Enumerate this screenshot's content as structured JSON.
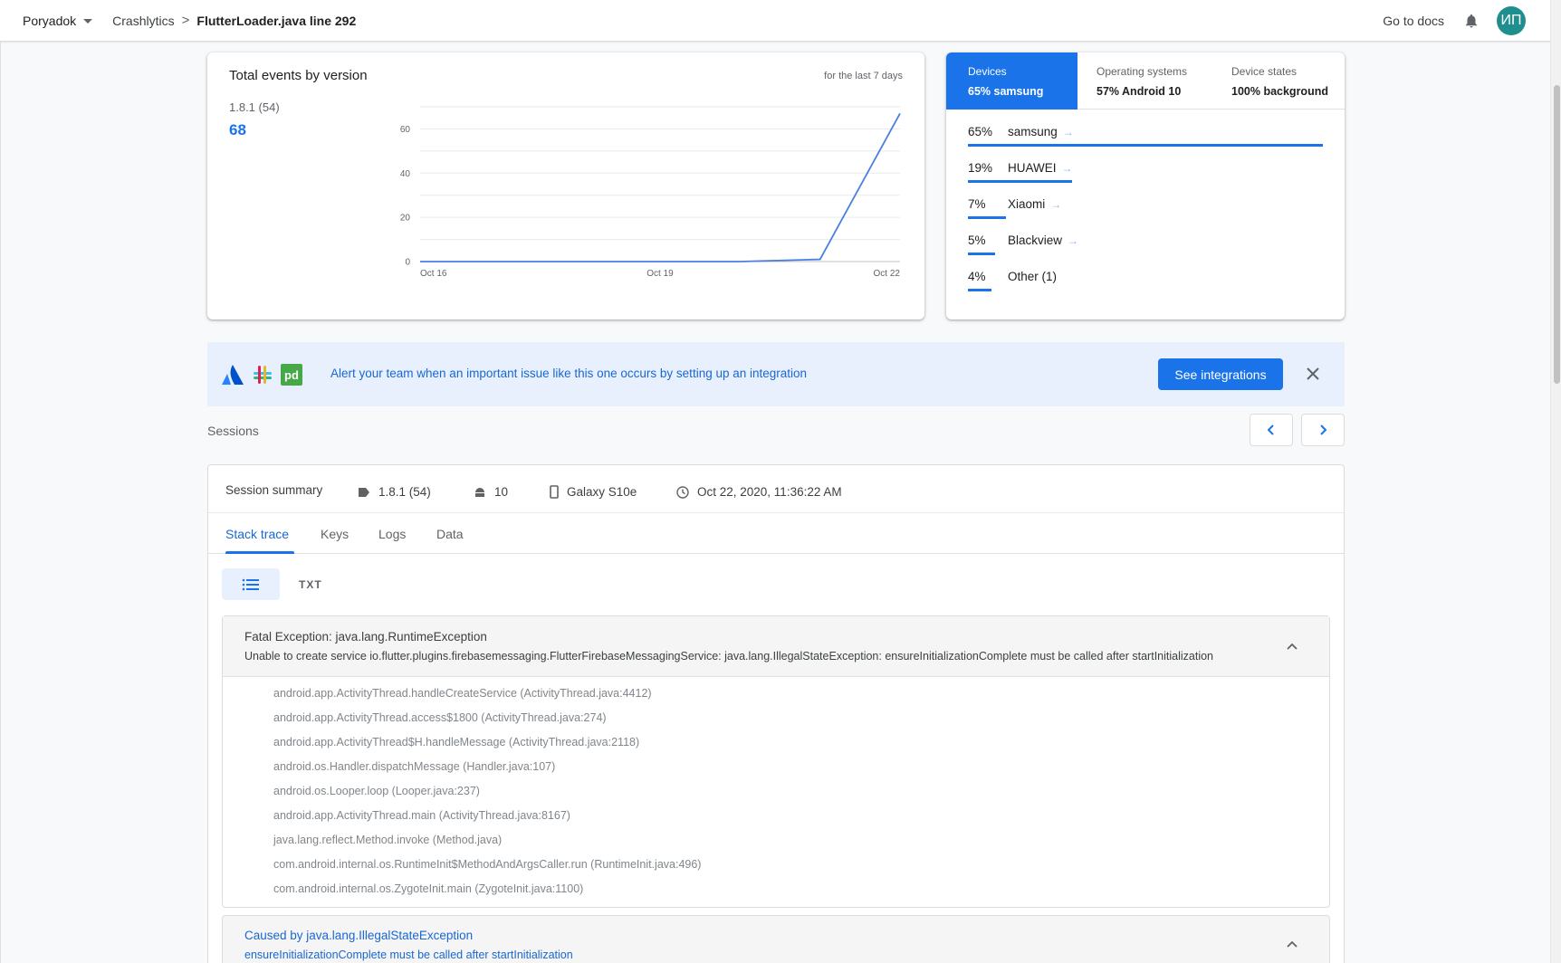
{
  "topbar": {
    "project": "Poryadok",
    "section": "Crashlytics",
    "separator": ">",
    "current": "FlutterLoader.java line 292",
    "docs": "Go to docs",
    "avatar": "ИП"
  },
  "chart_data": {
    "type": "line",
    "title": "Total events by version",
    "range_label": "for the last 7 days",
    "version_label": "1.8.1 (54)",
    "total": "68",
    "x": [
      "Oct 16",
      "Oct 17",
      "Oct 18",
      "Oct 19",
      "Oct 20",
      "Oct 21",
      "Oct 22"
    ],
    "x_tick_labels": [
      "Oct 16",
      "Oct 19",
      "Oct 22"
    ],
    "series": [
      {
        "values": [
          0,
          0,
          0,
          0,
          0,
          1,
          67
        ]
      }
    ],
    "y_ticks": [
      0,
      20,
      40,
      60
    ],
    "ylim": [
      0,
      70
    ],
    "grid": true,
    "color": "#4a7fe0"
  },
  "devices": {
    "tabs": [
      {
        "label": "Devices",
        "value": "65% samsung"
      },
      {
        "label": "Operating systems",
        "value": "57% Android 10"
      },
      {
        "label": "Device states",
        "value": "100% background"
      }
    ],
    "rows": [
      {
        "pct": "65%",
        "name": "samsung",
        "share": 65,
        "arrow": "→"
      },
      {
        "pct": "19%",
        "name": "HUAWEI",
        "share": 19,
        "arrow": "→"
      },
      {
        "pct": "7%",
        "name": "Xiaomi",
        "share": 7,
        "arrow": "→"
      },
      {
        "pct": "5%",
        "name": "Blackview",
        "share": 5,
        "arrow": "→"
      },
      {
        "pct": "4%",
        "name": "Other (1)",
        "share": 4,
        "arrow": ""
      }
    ]
  },
  "alert": {
    "message": "Alert your team when an important issue like this one occurs by setting up an integration",
    "button": "See integrations",
    "pd_logo": "pd"
  },
  "sessions": {
    "label": "Sessions",
    "summary_label": "Session summary",
    "version": "1.8.1 (54)",
    "os": "10",
    "device": "Galaxy S10e",
    "timestamp": "Oct 22, 2020, 11:36:22 AM",
    "tabs": [
      "Stack trace",
      "Keys",
      "Logs",
      "Data"
    ],
    "txt_toggle": "TXT"
  },
  "exception": {
    "title": "Fatal Exception: java.lang.RuntimeException",
    "message": "Unable to create service io.flutter.plugins.firebasemessaging.FlutterFirebaseMessagingService: java.lang.IllegalStateException: ensureInitializationComplete must be called after startInitialization",
    "frames": [
      "android.app.ActivityThread.handleCreateService (ActivityThread.java:4412)",
      "android.app.ActivityThread.access$1800 (ActivityThread.java:274)",
      "android.app.ActivityThread$H.handleMessage (ActivityThread.java:2118)",
      "android.os.Handler.dispatchMessage (Handler.java:107)",
      "android.os.Looper.loop (Looper.java:237)",
      "android.app.ActivityThread.main (ActivityThread.java:8167)",
      "java.lang.reflect.Method.invoke (Method.java)",
      "com.android.internal.os.RuntimeInit$MethodAndArgsCaller.run (RuntimeInit.java:496)",
      "com.android.internal.os.ZygoteInit.main (ZygoteInit.java:1100)"
    ]
  },
  "cause": {
    "title": "Caused by java.lang.IllegalStateException",
    "message": "ensureInitializationComplete must be called after startInitialization"
  }
}
